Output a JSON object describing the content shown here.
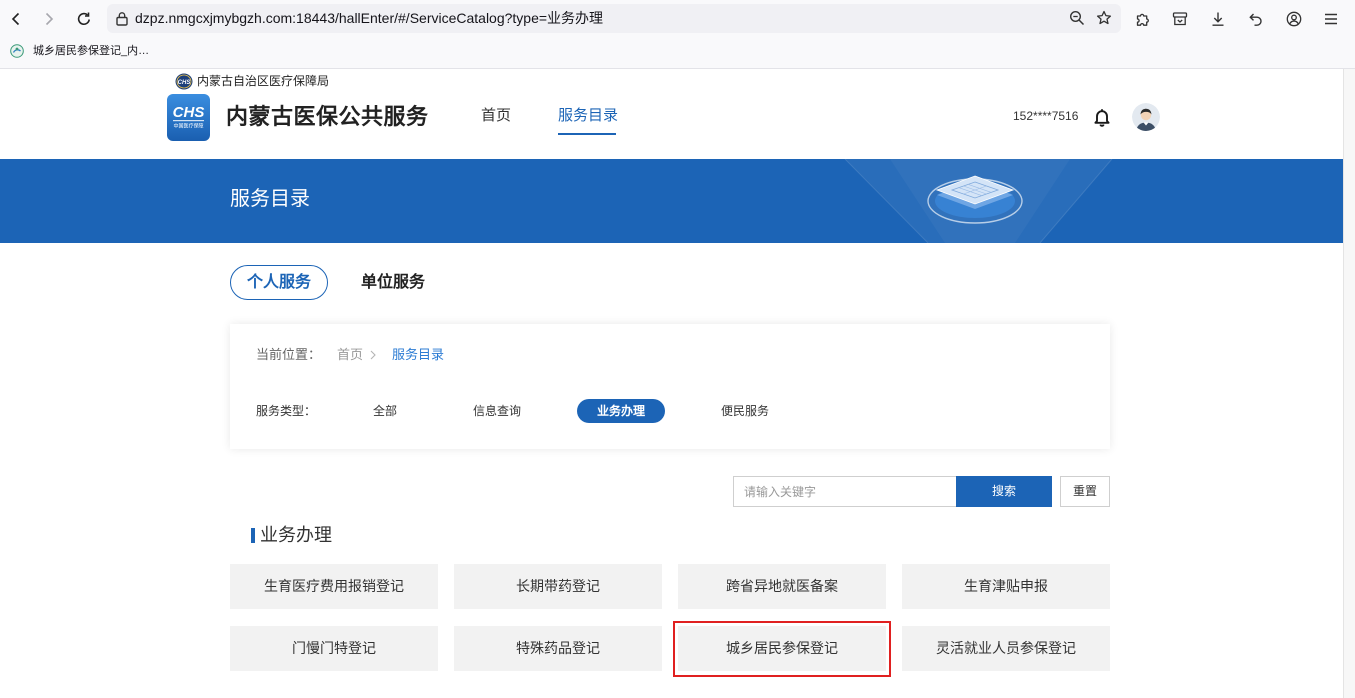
{
  "browser": {
    "url": "dzpz.nmgcxjmybgzh.com:18443/hallEnter/#/ServiceCatalog?type=业务办理",
    "bookmarks": [
      {
        "label": "城乡居民参保登记_内…",
        "icon": "site-favicon-icon"
      }
    ],
    "toolbar_icons": [
      "back-icon",
      "forward-icon",
      "reload-icon",
      "lock-icon",
      "zoom-out-icon",
      "star-icon",
      "extensions-icon",
      "pocket-icon",
      "download-icon",
      "history-icon",
      "account-icon",
      "menu-icon"
    ]
  },
  "header": {
    "small_logo_text": "CHS",
    "org_name": "内蒙古自治区医疗保障局",
    "logo_text": "CHS",
    "logo_subtext": "中国医疗保障",
    "site_title": "内蒙古医保公共服务",
    "nav": [
      {
        "label": "首页",
        "active": false
      },
      {
        "label": "服务目录",
        "active": true
      }
    ],
    "user_phone": "152****7516",
    "bell_icon": "bell-icon",
    "avatar_icon": "avatar-icon"
  },
  "banner": {
    "title": "服务目录"
  },
  "tabs": [
    {
      "label": "个人服务",
      "active": true
    },
    {
      "label": "单位服务",
      "active": false
    }
  ],
  "breadcrumb": {
    "prefix": "当前位置：",
    "items": [
      "首页",
      "服务目录"
    ],
    "separator_icon": "chevron-right-icon"
  },
  "filter": {
    "label": "服务类型：",
    "options": [
      {
        "label": "全部",
        "active": false
      },
      {
        "label": "信息查询",
        "active": false
      },
      {
        "label": "业务办理",
        "active": true
      },
      {
        "label": "便民服务",
        "active": false
      }
    ]
  },
  "search": {
    "placeholder": "请输入关键字",
    "value": "",
    "button": "搜索",
    "reset": "重置"
  },
  "section": {
    "title": "业务办理"
  },
  "services": [
    {
      "label": "生育医疗费用报销登记",
      "highlighted": false
    },
    {
      "label": "长期带药登记",
      "highlighted": false
    },
    {
      "label": "跨省异地就医备案",
      "highlighted": false
    },
    {
      "label": "生育津贴申报",
      "highlighted": false
    },
    {
      "label": "门慢门特登记",
      "highlighted": false
    },
    {
      "label": "特殊药品登记",
      "highlighted": false
    },
    {
      "label": "城乡居民参保登记",
      "highlighted": true
    },
    {
      "label": "灵活就业人员参保登记",
      "highlighted": false
    }
  ],
  "colors": {
    "accent": "#1c64b6",
    "banner": "#1c64b6",
    "tile_background": "#f2f2f2",
    "highlight_outline": "#e02020"
  }
}
